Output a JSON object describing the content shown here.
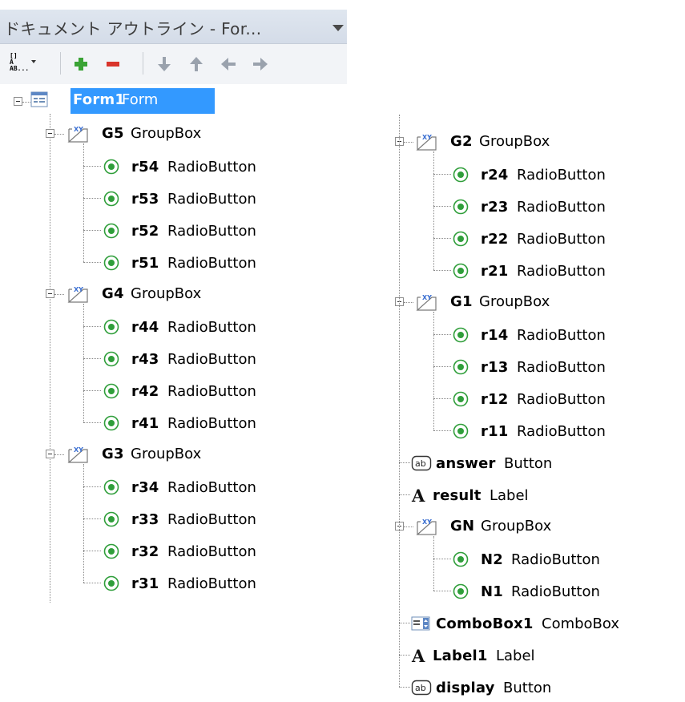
{
  "panel": {
    "title": "ドキュメント アウトライン - For...",
    "toolbar": {
      "view_toggle": "view-mode-icon",
      "add": "add-icon",
      "remove": "remove-icon",
      "move_down": "arrow-down-icon",
      "move_up": "arrow-up-icon",
      "move_left": "arrow-left-icon",
      "move_right": "arrow-right-icon"
    }
  },
  "colors": {
    "selection": "#3399ff",
    "radio_green": "#2f9e3a",
    "add_green": "#3aa335",
    "remove_red": "#d9342b"
  },
  "tree_left": {
    "root": {
      "name": "Form1",
      "type": "Form"
    },
    "groups": [
      {
        "name": "G5",
        "type": "GroupBox",
        "children": [
          {
            "name": "r54",
            "type": "RadioButton"
          },
          {
            "name": "r53",
            "type": "RadioButton"
          },
          {
            "name": "r52",
            "type": "RadioButton"
          },
          {
            "name": "r51",
            "type": "RadioButton"
          }
        ]
      },
      {
        "name": "G4",
        "type": "GroupBox",
        "children": [
          {
            "name": "r44",
            "type": "RadioButton"
          },
          {
            "name": "r43",
            "type": "RadioButton"
          },
          {
            "name": "r42",
            "type": "RadioButton"
          },
          {
            "name": "r41",
            "type": "RadioButton"
          }
        ]
      },
      {
        "name": "G3",
        "type": "GroupBox",
        "children": [
          {
            "name": "r34",
            "type": "RadioButton"
          },
          {
            "name": "r33",
            "type": "RadioButton"
          },
          {
            "name": "r32",
            "type": "RadioButton"
          },
          {
            "name": "r31",
            "type": "RadioButton"
          }
        ]
      }
    ]
  },
  "tree_right": [
    {
      "kind": "group",
      "name": "G2",
      "type": "GroupBox",
      "children": [
        {
          "name": "r24",
          "type": "RadioButton"
        },
        {
          "name": "r23",
          "type": "RadioButton"
        },
        {
          "name": "r22",
          "type": "RadioButton"
        },
        {
          "name": "r21",
          "type": "RadioButton"
        }
      ]
    },
    {
      "kind": "group",
      "name": "G1",
      "type": "GroupBox",
      "children": [
        {
          "name": "r14",
          "type": "RadioButton"
        },
        {
          "name": "r13",
          "type": "RadioButton"
        },
        {
          "name": "r12",
          "type": "RadioButton"
        },
        {
          "name": "r11",
          "type": "RadioButton"
        }
      ]
    },
    {
      "kind": "button",
      "name": "answer",
      "type": "Button"
    },
    {
      "kind": "label",
      "name": "result",
      "type": "Label"
    },
    {
      "kind": "group",
      "name": "GN",
      "type": "GroupBox",
      "children": [
        {
          "name": "N2",
          "type": "RadioButton"
        },
        {
          "name": "N1",
          "type": "RadioButton"
        }
      ]
    },
    {
      "kind": "combobox",
      "name": "ComboBox1",
      "type": "ComboBox"
    },
    {
      "kind": "label",
      "name": "Label1",
      "type": "Label"
    },
    {
      "kind": "button",
      "name": "display",
      "type": "Button"
    }
  ]
}
